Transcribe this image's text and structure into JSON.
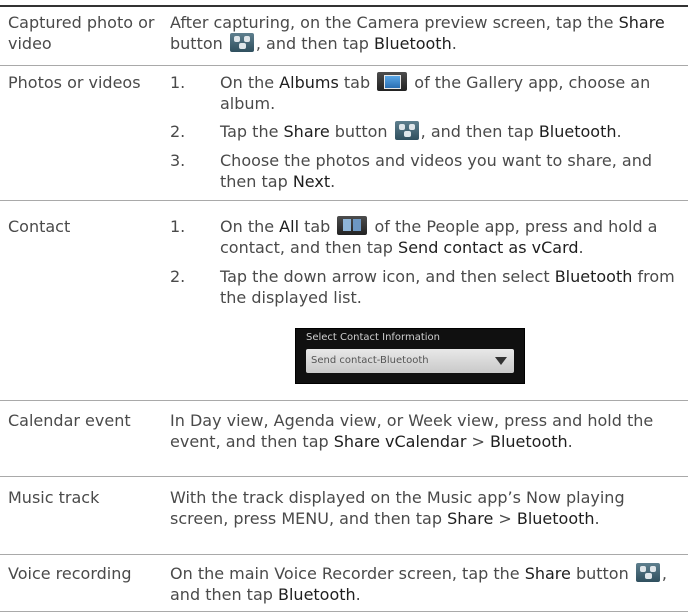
{
  "rows": [
    {
      "label": "Captured photo or video",
      "text_parts": [
        "After capturing, on the Camera preview screen, tap the ",
        "Share",
        " button ",
        ", and then tap ",
        "Bluetooth",
        "."
      ]
    },
    {
      "label": "Photos or videos",
      "steps": [
        {
          "num": "1.",
          "parts": [
            "On the ",
            "Albums",
            " tab ",
            " of the Gallery app, choose an album."
          ]
        },
        {
          "num": "2.",
          "parts": [
            "Tap the ",
            "Share",
            " button ",
            ", and then tap ",
            "Bluetooth",
            "."
          ]
        },
        {
          "num": "3.",
          "parts": [
            "Choose the photos and videos you want to share, and then tap ",
            "Next",
            "."
          ]
        }
      ]
    },
    {
      "label": "Contact",
      "steps": [
        {
          "num": "1.",
          "parts": [
            "On the ",
            "All",
            " tab ",
            " of the People app, press and hold a contact, and then tap ",
            "Send contact as vCard",
            "."
          ]
        },
        {
          "num": "2.",
          "parts": [
            "Tap the down arrow icon, and then select ",
            "Bluetooth",
            " from the displayed list."
          ]
        }
      ],
      "screenshot": {
        "title": "Select Contact Information",
        "value": "Send contact-Bluetooth"
      }
    },
    {
      "label": "Calendar event",
      "text_parts": [
        "In Day view, Agenda view, or Week view, press and hold the event, and then tap ",
        "Share vCalendar",
        " > ",
        "Bluetooth",
        "."
      ]
    },
    {
      "label": "Music track",
      "text_parts": [
        "With the track displayed on the Music app’s Now playing screen, press MENU, and then tap ",
        "Share",
        " > ",
        "Bluetooth",
        "."
      ]
    },
    {
      "label": "Voice recording",
      "text_parts": [
        "On the main Voice Recorder screen, tap the ",
        "Share",
        " button ",
        ", and then tap ",
        "Bluetooth",
        "."
      ]
    }
  ],
  "icons": {
    "share": "share-icon",
    "albums": "albums-tab-icon",
    "all": "all-tab-icon",
    "dropdown": "chevron-down-icon"
  },
  "colors": {
    "rule": "#a9a9a9",
    "text": "#4a4a4a",
    "emphasis": "#1e1e1e"
  }
}
